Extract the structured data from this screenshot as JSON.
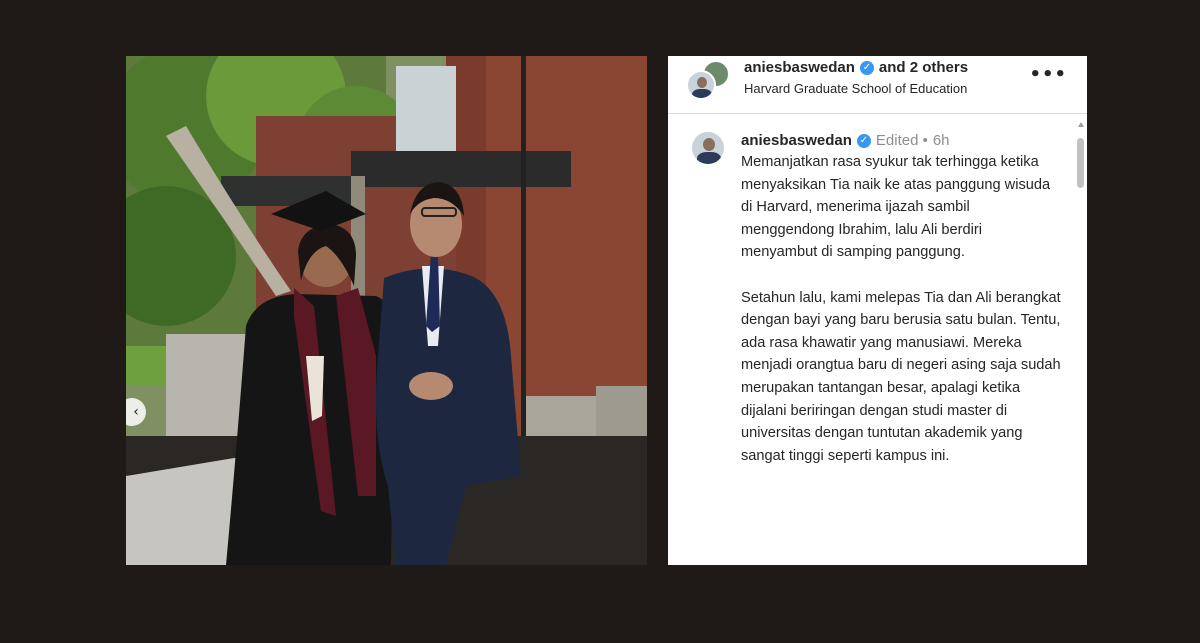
{
  "post": {
    "header": {
      "username": "aniesbaswedan",
      "others": "and 2 others",
      "location": "Harvard Graduate School of Education",
      "more_icon": "more-horizontal-icon"
    },
    "caption": {
      "username": "aniesbaswedan",
      "edited": "Edited •",
      "time": "6h",
      "paragraph1": "Memanjatkan rasa syukur tak terhingga ketika menyaksikan Tia naik ke atas panggung wisuda di Harvard, menerima ijazah sambil menggendong Ibrahim, lalu Ali berdiri menyambut di samping panggung.",
      "paragraph2": "Setahun lalu, kami melepas Tia dan Ali berangkat dengan bayi yang baru berusia satu bulan. Tentu, ada rasa khawatir yang manusiawi. Mereka menjadi orangtua baru di negeri asing saja sudah merupakan tantangan besar, apalagi ketika dijalani beriringan dengan studi master di universitas dengan tuntutan akademik yang sangat tinggi seperti kampus ini."
    }
  },
  "colors": {
    "background": "#1f1a18",
    "verified": "#3897f0",
    "text": "#262626",
    "muted": "#8e8e8e"
  }
}
